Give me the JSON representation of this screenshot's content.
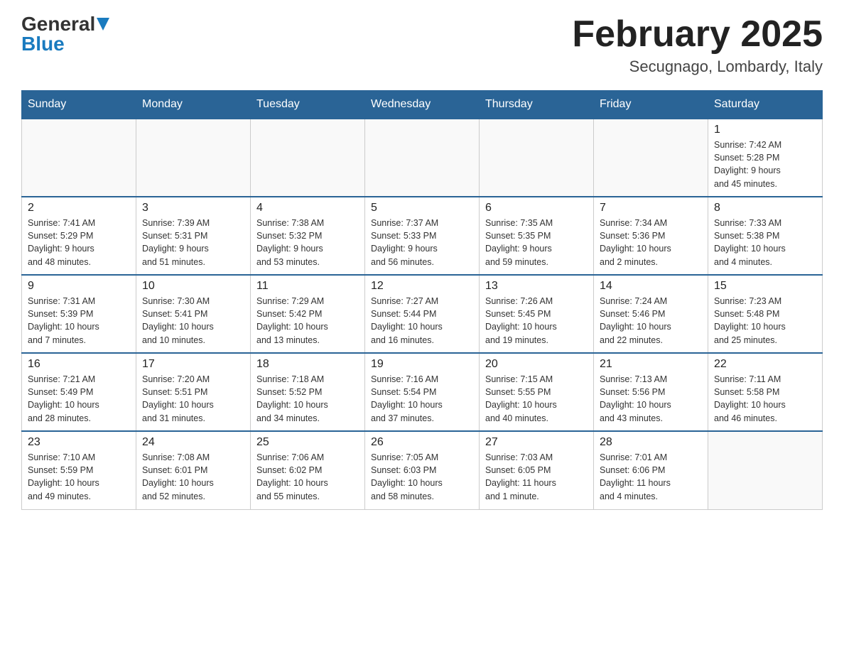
{
  "logo": {
    "general": "General",
    "blue": "Blue"
  },
  "title": "February 2025",
  "location": "Secugnago, Lombardy, Italy",
  "days_of_week": [
    "Sunday",
    "Monday",
    "Tuesday",
    "Wednesday",
    "Thursday",
    "Friday",
    "Saturday"
  ],
  "weeks": [
    [
      {
        "day": "",
        "info": ""
      },
      {
        "day": "",
        "info": ""
      },
      {
        "day": "",
        "info": ""
      },
      {
        "day": "",
        "info": ""
      },
      {
        "day": "",
        "info": ""
      },
      {
        "day": "",
        "info": ""
      },
      {
        "day": "1",
        "info": "Sunrise: 7:42 AM\nSunset: 5:28 PM\nDaylight: 9 hours\nand 45 minutes."
      }
    ],
    [
      {
        "day": "2",
        "info": "Sunrise: 7:41 AM\nSunset: 5:29 PM\nDaylight: 9 hours\nand 48 minutes."
      },
      {
        "day": "3",
        "info": "Sunrise: 7:39 AM\nSunset: 5:31 PM\nDaylight: 9 hours\nand 51 minutes."
      },
      {
        "day": "4",
        "info": "Sunrise: 7:38 AM\nSunset: 5:32 PM\nDaylight: 9 hours\nand 53 minutes."
      },
      {
        "day": "5",
        "info": "Sunrise: 7:37 AM\nSunset: 5:33 PM\nDaylight: 9 hours\nand 56 minutes."
      },
      {
        "day": "6",
        "info": "Sunrise: 7:35 AM\nSunset: 5:35 PM\nDaylight: 9 hours\nand 59 minutes."
      },
      {
        "day": "7",
        "info": "Sunrise: 7:34 AM\nSunset: 5:36 PM\nDaylight: 10 hours\nand 2 minutes."
      },
      {
        "day": "8",
        "info": "Sunrise: 7:33 AM\nSunset: 5:38 PM\nDaylight: 10 hours\nand 4 minutes."
      }
    ],
    [
      {
        "day": "9",
        "info": "Sunrise: 7:31 AM\nSunset: 5:39 PM\nDaylight: 10 hours\nand 7 minutes."
      },
      {
        "day": "10",
        "info": "Sunrise: 7:30 AM\nSunset: 5:41 PM\nDaylight: 10 hours\nand 10 minutes."
      },
      {
        "day": "11",
        "info": "Sunrise: 7:29 AM\nSunset: 5:42 PM\nDaylight: 10 hours\nand 13 minutes."
      },
      {
        "day": "12",
        "info": "Sunrise: 7:27 AM\nSunset: 5:44 PM\nDaylight: 10 hours\nand 16 minutes."
      },
      {
        "day": "13",
        "info": "Sunrise: 7:26 AM\nSunset: 5:45 PM\nDaylight: 10 hours\nand 19 minutes."
      },
      {
        "day": "14",
        "info": "Sunrise: 7:24 AM\nSunset: 5:46 PM\nDaylight: 10 hours\nand 22 minutes."
      },
      {
        "day": "15",
        "info": "Sunrise: 7:23 AM\nSunset: 5:48 PM\nDaylight: 10 hours\nand 25 minutes."
      }
    ],
    [
      {
        "day": "16",
        "info": "Sunrise: 7:21 AM\nSunset: 5:49 PM\nDaylight: 10 hours\nand 28 minutes."
      },
      {
        "day": "17",
        "info": "Sunrise: 7:20 AM\nSunset: 5:51 PM\nDaylight: 10 hours\nand 31 minutes."
      },
      {
        "day": "18",
        "info": "Sunrise: 7:18 AM\nSunset: 5:52 PM\nDaylight: 10 hours\nand 34 minutes."
      },
      {
        "day": "19",
        "info": "Sunrise: 7:16 AM\nSunset: 5:54 PM\nDaylight: 10 hours\nand 37 minutes."
      },
      {
        "day": "20",
        "info": "Sunrise: 7:15 AM\nSunset: 5:55 PM\nDaylight: 10 hours\nand 40 minutes."
      },
      {
        "day": "21",
        "info": "Sunrise: 7:13 AM\nSunset: 5:56 PM\nDaylight: 10 hours\nand 43 minutes."
      },
      {
        "day": "22",
        "info": "Sunrise: 7:11 AM\nSunset: 5:58 PM\nDaylight: 10 hours\nand 46 minutes."
      }
    ],
    [
      {
        "day": "23",
        "info": "Sunrise: 7:10 AM\nSunset: 5:59 PM\nDaylight: 10 hours\nand 49 minutes."
      },
      {
        "day": "24",
        "info": "Sunrise: 7:08 AM\nSunset: 6:01 PM\nDaylight: 10 hours\nand 52 minutes."
      },
      {
        "day": "25",
        "info": "Sunrise: 7:06 AM\nSunset: 6:02 PM\nDaylight: 10 hours\nand 55 minutes."
      },
      {
        "day": "26",
        "info": "Sunrise: 7:05 AM\nSunset: 6:03 PM\nDaylight: 10 hours\nand 58 minutes."
      },
      {
        "day": "27",
        "info": "Sunrise: 7:03 AM\nSunset: 6:05 PM\nDaylight: 11 hours\nand 1 minute."
      },
      {
        "day": "28",
        "info": "Sunrise: 7:01 AM\nSunset: 6:06 PM\nDaylight: 11 hours\nand 4 minutes."
      },
      {
        "day": "",
        "info": ""
      }
    ]
  ]
}
